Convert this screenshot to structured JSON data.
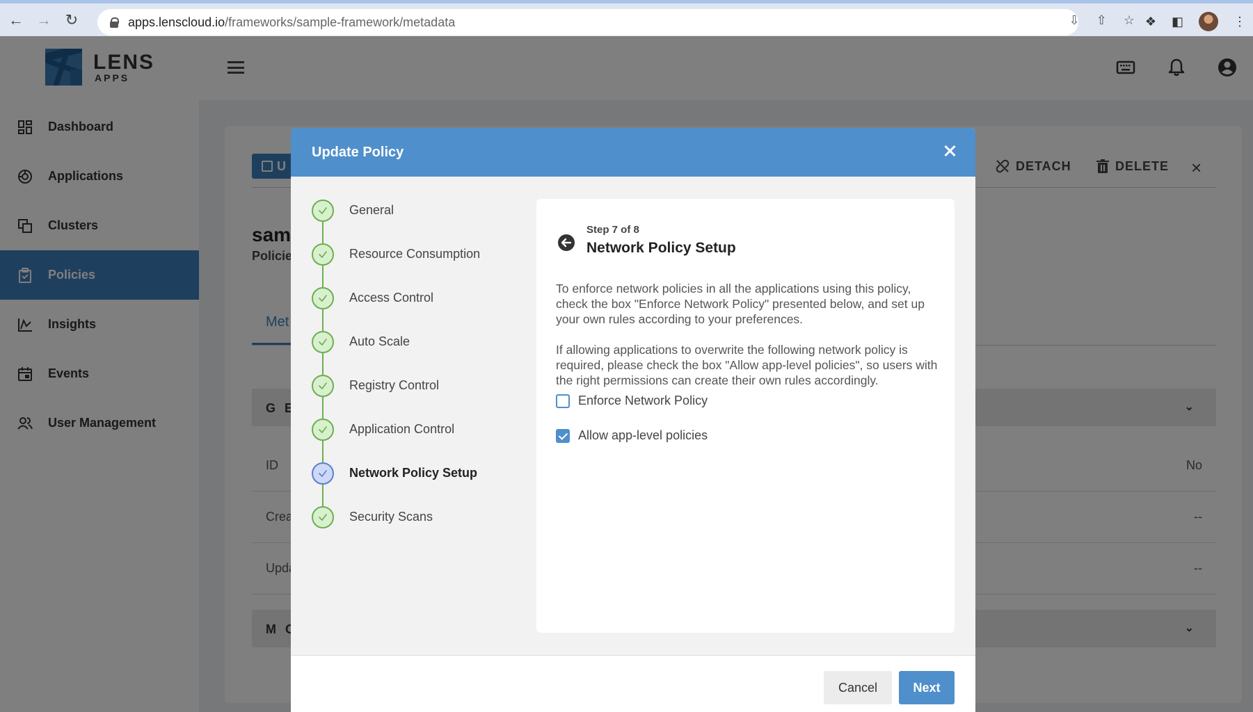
{
  "browser": {
    "url_host": "apps.lenscloud.io",
    "url_path": "/frameworks/sample-framework/metadata"
  },
  "header": {
    "logo_name": "LENS",
    "logo_sub": "APPS"
  },
  "sidebar": {
    "items": [
      {
        "label": "Dashboard",
        "icon": "dashboard-icon"
      },
      {
        "label": "Applications",
        "icon": "applications-icon"
      },
      {
        "label": "Clusters",
        "icon": "clusters-icon"
      },
      {
        "label": "Policies",
        "icon": "policies-icon",
        "active": true
      },
      {
        "label": "Insights",
        "icon": "insights-icon"
      },
      {
        "label": "Events",
        "icon": "events-icon"
      },
      {
        "label": "User Management",
        "icon": "users-icon"
      }
    ]
  },
  "background": {
    "update_label": "U",
    "detach_label": "DETACH",
    "delete_label": "DELETE",
    "title": "sam",
    "subtitle": "Policie",
    "tab": "Met",
    "section_general": "G E",
    "section_more": "M O",
    "rows": [
      {
        "label": "ID",
        "value": "No"
      },
      {
        "label": "Crea",
        "value": "--"
      },
      {
        "label": "Upda",
        "value": "--"
      }
    ]
  },
  "modal": {
    "title": "Update Policy",
    "steps": [
      {
        "label": "General",
        "state": "done"
      },
      {
        "label": "Resource Consumption",
        "state": "done"
      },
      {
        "label": "Access Control",
        "state": "done"
      },
      {
        "label": "Auto Scale",
        "state": "done"
      },
      {
        "label": "Registry Control",
        "state": "done"
      },
      {
        "label": "Application Control",
        "state": "done"
      },
      {
        "label": "Network Policy Setup",
        "state": "current"
      },
      {
        "label": "Security Scans",
        "state": "done"
      }
    ],
    "step_count": "Step 7 of 8",
    "step_title": "Network Policy Setup",
    "paragraph1": "To enforce network policies in all the applications using this policy, check the box \"Enforce Network Policy\" presented below, and set up your own rules according to your preferences.",
    "paragraph2": "If allowing applications to overwrite the following network policy is required, please check the box \"Allow app-level policies\", so users with the right permissions can create their own rules accordingly.",
    "checkboxes": [
      {
        "label": "Enforce Network Policy",
        "checked": false
      },
      {
        "label": "Allow app-level policies",
        "checked": true
      }
    ],
    "cancel_label": "Cancel",
    "next_label": "Next"
  },
  "colors": {
    "accent": "#4f8fcb",
    "step_done": "#6ab04c",
    "step_current": "#5b7fd1"
  }
}
